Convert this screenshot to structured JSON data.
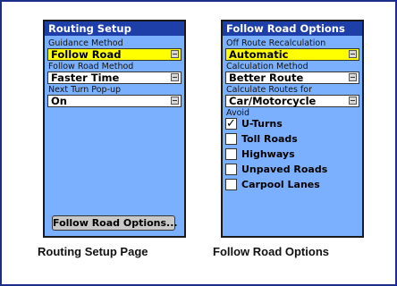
{
  "routing_setup": {
    "title": "Routing Setup",
    "fields": [
      {
        "label": "Guidance Method",
        "value": "Follow Road",
        "highlighted": true
      },
      {
        "label": "Follow Road Method",
        "value": "Faster Time",
        "highlighted": false
      },
      {
        "label": "Next Turn Pop-up",
        "value": "On",
        "highlighted": false
      }
    ],
    "button_label": "Follow Road Options..."
  },
  "follow_road_options": {
    "title": "Follow Road Options",
    "fields": [
      {
        "label": "Off Route Recalculation",
        "value": "Automatic",
        "highlighted": true
      },
      {
        "label": "Calculation Method",
        "value": "Better Route",
        "highlighted": false
      },
      {
        "label": "Calculate Routes for",
        "value": "Car/Motorcycle",
        "highlighted": false
      }
    ],
    "avoid_label": "Avoid",
    "avoid_items": [
      {
        "label": "U-Turns",
        "checked": true,
        "mark": "✓"
      },
      {
        "label": "Toll Roads",
        "checked": false,
        "mark": ""
      },
      {
        "label": "Highways",
        "checked": false,
        "mark": ""
      },
      {
        "label": "Unpaved Roads",
        "checked": false,
        "mark": ""
      },
      {
        "label": "Carpool Lanes",
        "checked": false,
        "mark": ""
      }
    ]
  },
  "captions": {
    "left": "Routing Setup Page",
    "right": "Follow Road Options"
  },
  "colors": {
    "screen_bg": "#7ab0ff",
    "title_bg": "#1f3fa8",
    "highlight": "#ffff00",
    "frame_border": "#1a2e8a"
  }
}
